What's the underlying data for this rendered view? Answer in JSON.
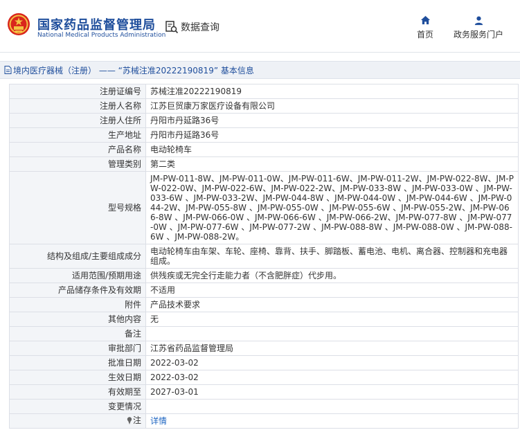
{
  "header": {
    "site_name_cn": "国家药品监督管理局",
    "site_name_en": "National Medical Products Administration",
    "query_label": "数据查询",
    "nav": [
      {
        "label": "首页",
        "icon": "home-icon"
      },
      {
        "label": "政务服务门户",
        "icon": "user-icon"
      }
    ]
  },
  "breadcrumb": {
    "text": "境内医疗器械（注册） —— “苏械注准20222190819” 基本信息"
  },
  "rows": [
    {
      "label": "注册证编号",
      "value": "苏械注准20222190819"
    },
    {
      "label": "注册人名称",
      "value": "江苏巨贸康万家医疗设备有限公司"
    },
    {
      "label": "注册人住所",
      "value": "丹阳市丹延路36号"
    },
    {
      "label": "生产地址",
      "value": "丹阳市丹延路36号"
    },
    {
      "label": "产品名称",
      "value": "电动轮椅车"
    },
    {
      "label": "管理类别",
      "value": "第二类"
    },
    {
      "label": "型号规格",
      "value": "JM-PW-011-8W、JM-PW-011-0W、JM-PW-011-6W、JM-PW-011-2W、JM-PW-022-8W、JM-PW-022-0W、JM-PW-022-6W、JM-PW-022-2W、JM-PW-033-8W 、JM-PW-033-0W 、JM-PW-033-6W 、JM-PW-033-2W、JM-PW-044-8W 、JM-PW-044-0W 、JM-PW-044-6W 、JM-PW-044-2W、JM-PW-055-8W 、JM-PW-055-0W 、JM-PW-055-6W 、JM-PW-055-2W、JM-PW-066-8W 、JM-PW-066-0W 、JM-PW-066-6W 、JM-PW-066-2W、JM-PW-077-8W 、JM-PW-077-0W 、JM-PW-077-6W 、JM-PW-077-2W 、JM-PW-088-8W 、JM-PW-088-0W 、JM-PW-088-6W 、JM-PW-088-2W。"
    },
    {
      "label": "结构及组成/主要组成成分",
      "value": "电动轮椅车由车架、车轮、座椅、靠背、扶手、脚踏板、蓄电池、电机、离合器、控制器和充电器组成。"
    },
    {
      "label": "适用范围/预期用途",
      "value": "供残疾或无完全行走能力者（不含肥胖症）代步用。"
    },
    {
      "label": "产品储存条件及有效期",
      "value": "不适用"
    },
    {
      "label": "附件",
      "value": "产品技术要求"
    },
    {
      "label": "其他内容",
      "value": "无"
    },
    {
      "label": "备注",
      "value": ""
    },
    {
      "label": "审批部门",
      "value": "江苏省药品监督管理局"
    },
    {
      "label": "批准日期",
      "value": "2022-03-02"
    },
    {
      "label": "生效日期",
      "value": "2022-03-02"
    },
    {
      "label": "有效期至",
      "value": "2027-03-01"
    },
    {
      "label": "变更情况",
      "value": ""
    }
  ],
  "note_row": {
    "label": "注",
    "link": "详情"
  }
}
